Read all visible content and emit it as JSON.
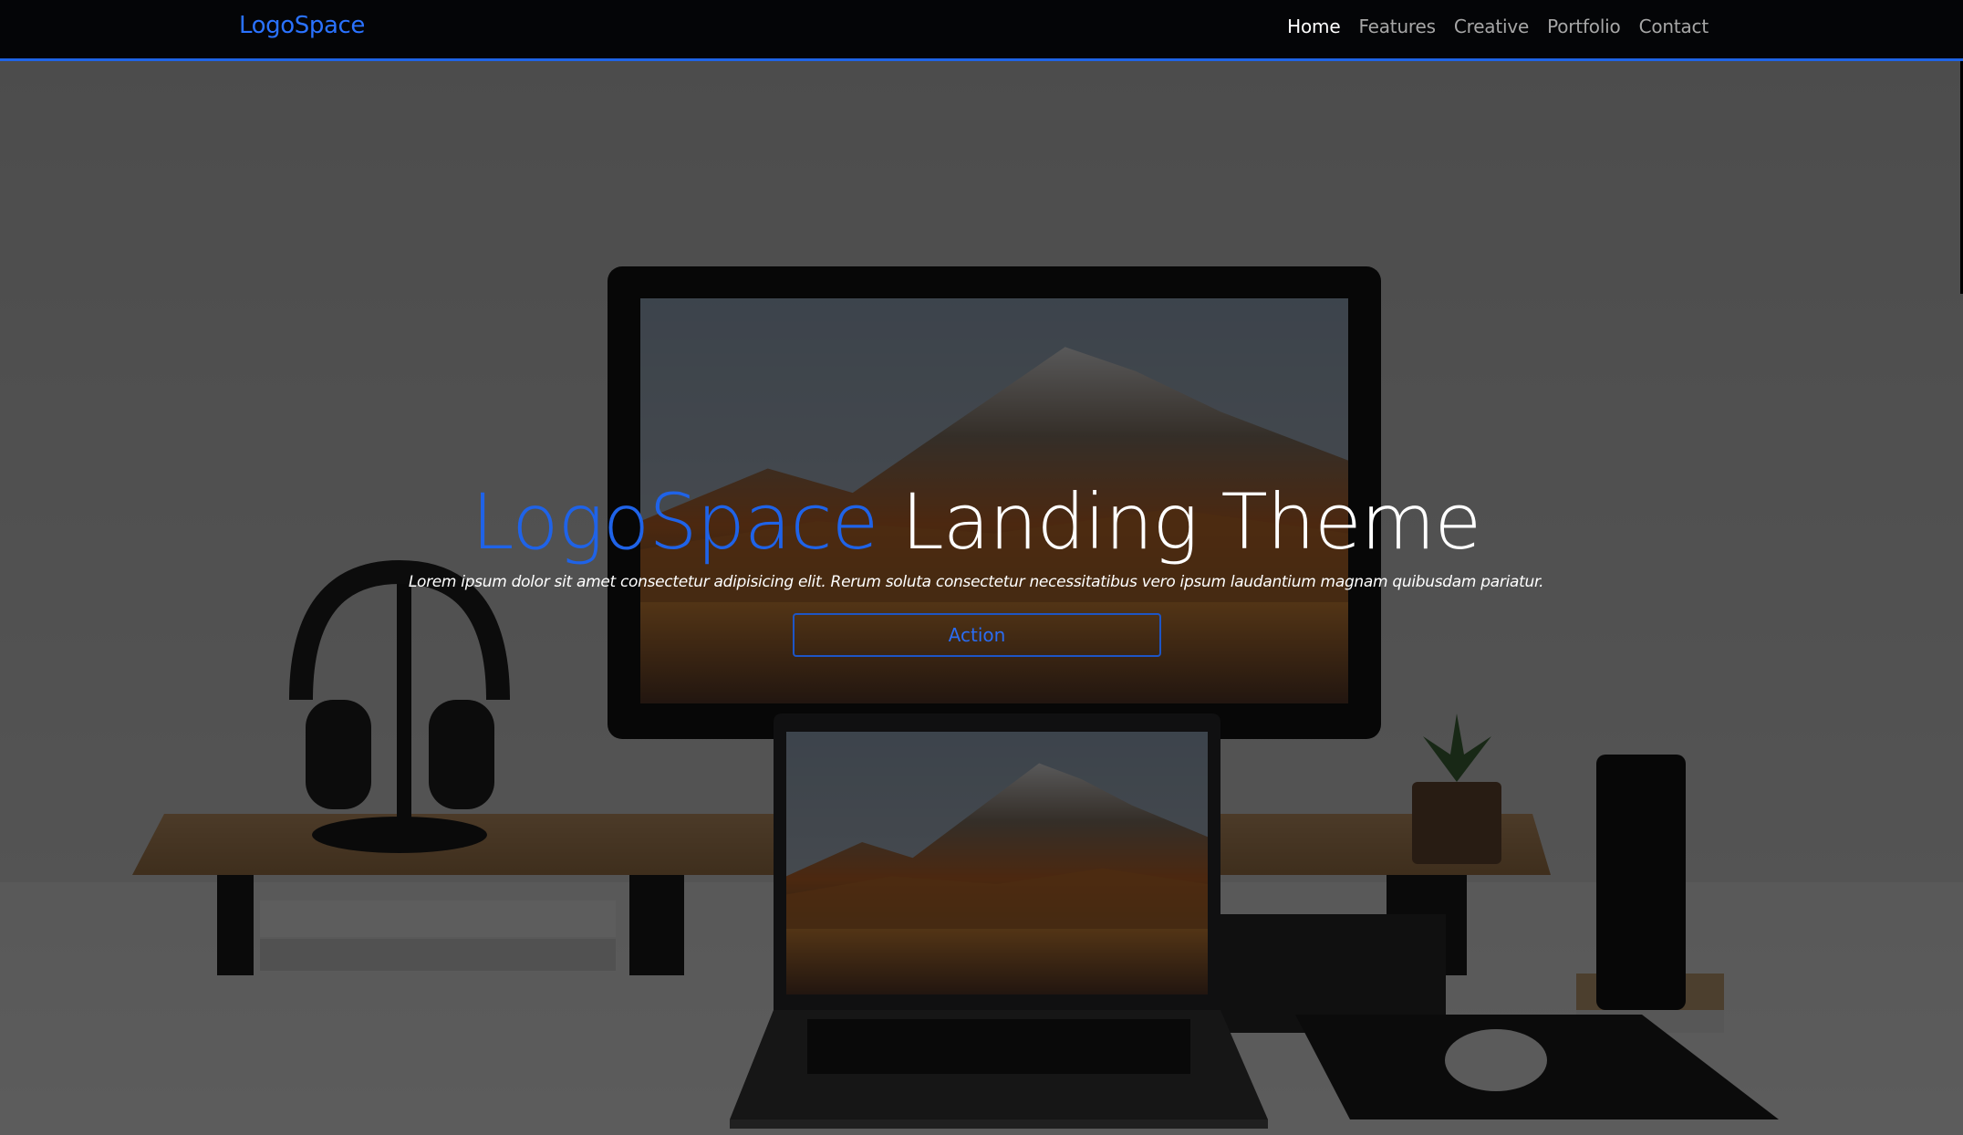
{
  "navbar": {
    "brand": "LogoSpace",
    "links": [
      {
        "label": "Home",
        "active": true
      },
      {
        "label": "Features",
        "active": false
      },
      {
        "label": "Creative",
        "active": false
      },
      {
        "label": "Portfolio",
        "active": false
      },
      {
        "label": "Contact",
        "active": false
      }
    ]
  },
  "hero": {
    "title_accent": "LogoSpace",
    "title_rest": "Landing Theme",
    "subtitle": "Lorem ipsum dolor sit amet consectetur adipisicing elit. Rerum soluta consectetur necessitatibus vero ipsum laudantium magnam quibusdam pariatur.",
    "action_label": "Action"
  },
  "colors": {
    "accent": "#1f63e8",
    "nav_background": "#040507",
    "nav_border": "#1f64e6",
    "nav_link": "#a6a6a6",
    "nav_link_active": "#ffffff"
  }
}
